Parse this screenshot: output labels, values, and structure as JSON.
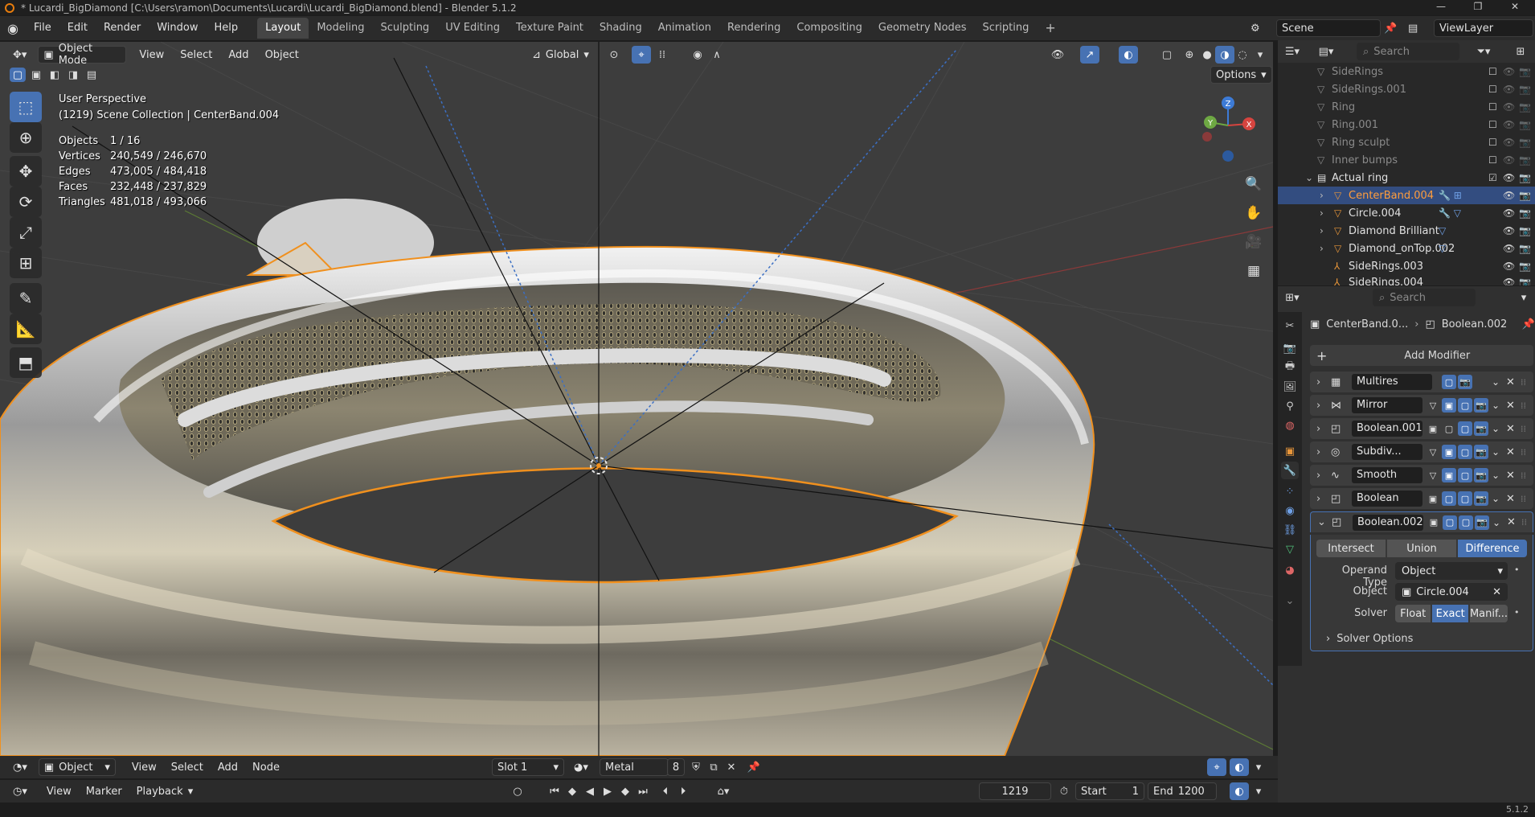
{
  "titlebar": {
    "title": "* Lucardi_BigDiamond [C:\\Users\\ramon\\Documents\\Lucardi\\Lucardi_BigDiamond.blend] - Blender 5.1.2"
  },
  "menu": [
    "File",
    "Edit",
    "Render",
    "Window",
    "Help"
  ],
  "workspaces": [
    "Layout",
    "Modeling",
    "Sculpting",
    "UV Editing",
    "Texture Paint",
    "Shading",
    "Animation",
    "Rendering",
    "Compositing",
    "Geometry Nodes",
    "Scripting"
  ],
  "active_workspace": "Layout",
  "scene": {
    "name": "Scene",
    "view_layer": "ViewLayer"
  },
  "viewport_header": {
    "mode": "Object Mode",
    "menus": [
      "View",
      "Select",
      "Add",
      "Object"
    ],
    "orientation": "Global",
    "options": "Options"
  },
  "viewport_info": {
    "perspective": "User Perspective",
    "collection": "(1219) Scene Collection | CenterBand.004",
    "stats": [
      {
        "label": "Objects",
        "value": "1 / 16"
      },
      {
        "label": "Vertices",
        "value": "240,549 / 246,670"
      },
      {
        "label": "Edges",
        "value": "473,005 / 484,418"
      },
      {
        "label": "Faces",
        "value": "232,448 / 237,829"
      },
      {
        "label": "Triangles",
        "value": "481,018 / 493,066"
      }
    ]
  },
  "gizmo": {
    "x": "X",
    "y": "Y",
    "z": "Z"
  },
  "shader_header": {
    "editor_mode": "Object",
    "menus": [
      "View",
      "Select",
      "Add",
      "Node"
    ],
    "slot": "Slot 1",
    "material": "Metal",
    "users": "8"
  },
  "timeline": {
    "menus": [
      "View",
      "Marker",
      "Playback"
    ],
    "current_frame": "1219",
    "start_label": "Start",
    "start": "1",
    "end_label": "End",
    "end": "1200"
  },
  "status": {
    "version": "5.1.2"
  },
  "outliner": {
    "search_placeholder": "Search",
    "items": [
      {
        "name": "SideRings",
        "dim": true
      },
      {
        "name": "SideRings.001",
        "dim": true
      },
      {
        "name": "Ring",
        "dim": true
      },
      {
        "name": "Ring.001",
        "dim": true
      },
      {
        "name": "Ring sculpt",
        "dim": true
      },
      {
        "name": "Inner bumps",
        "dim": true
      },
      {
        "name": "Actual ring",
        "dim": false
      },
      {
        "name": "CenterBand.004",
        "dim": false
      },
      {
        "name": "Circle.004",
        "dim": false
      },
      {
        "name": "Diamond Brilliant",
        "dim": false
      },
      {
        "name": "Diamond_onTop.002",
        "dim": false
      },
      {
        "name": "SideRings.003",
        "dim": false
      },
      {
        "name": "SideRings.004",
        "dim": false
      }
    ]
  },
  "properties": {
    "search_placeholder": "Search",
    "object": "CenterBand.0...",
    "modifier": "Boolean.002",
    "add_modifier": "Add Modifier",
    "modifiers": [
      "Multires",
      "Mirror",
      "Boolean.001",
      "Subdiv...",
      "Smooth",
      "Boolean",
      "Boolean.002"
    ],
    "operations": [
      "Intersect",
      "Union",
      "Difference"
    ],
    "active_operation": "Difference",
    "operand_type_label": "Operand Type",
    "operand_type": "Object",
    "object_label": "Object",
    "object_value": "Circle.004",
    "solver_label": "Solver",
    "solvers": [
      "Float",
      "Exact",
      "Manif..."
    ],
    "active_solver": "Exact",
    "solver_options": "Solver Options"
  },
  "colors": {
    "accent": "#4772b3",
    "selection_outline": "#f0901e",
    "brand": "#e87d0d"
  }
}
